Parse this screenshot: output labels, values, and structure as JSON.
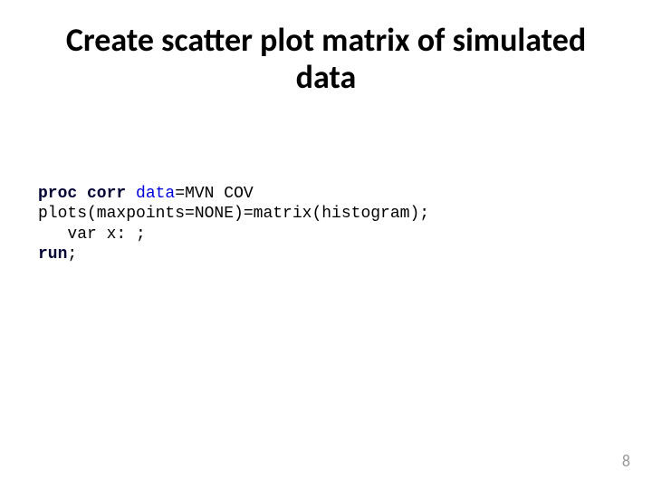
{
  "title": "Create scatter plot matrix of simulated data",
  "code": {
    "kw_proc_corr": "proc corr",
    "sp1": " ",
    "opt_data": "data",
    "eq1": "=",
    "id_mvn": "MVN",
    "sp2": " ",
    "id_cov": "COV",
    "line2": "plots(maxpoints=NONE)=matrix(histogram);",
    "line3_indent": "   ",
    "line3_var": "var",
    "line3_rest": " x: ;",
    "kw_run": "run",
    "semi": ";"
  },
  "page_number": "8"
}
